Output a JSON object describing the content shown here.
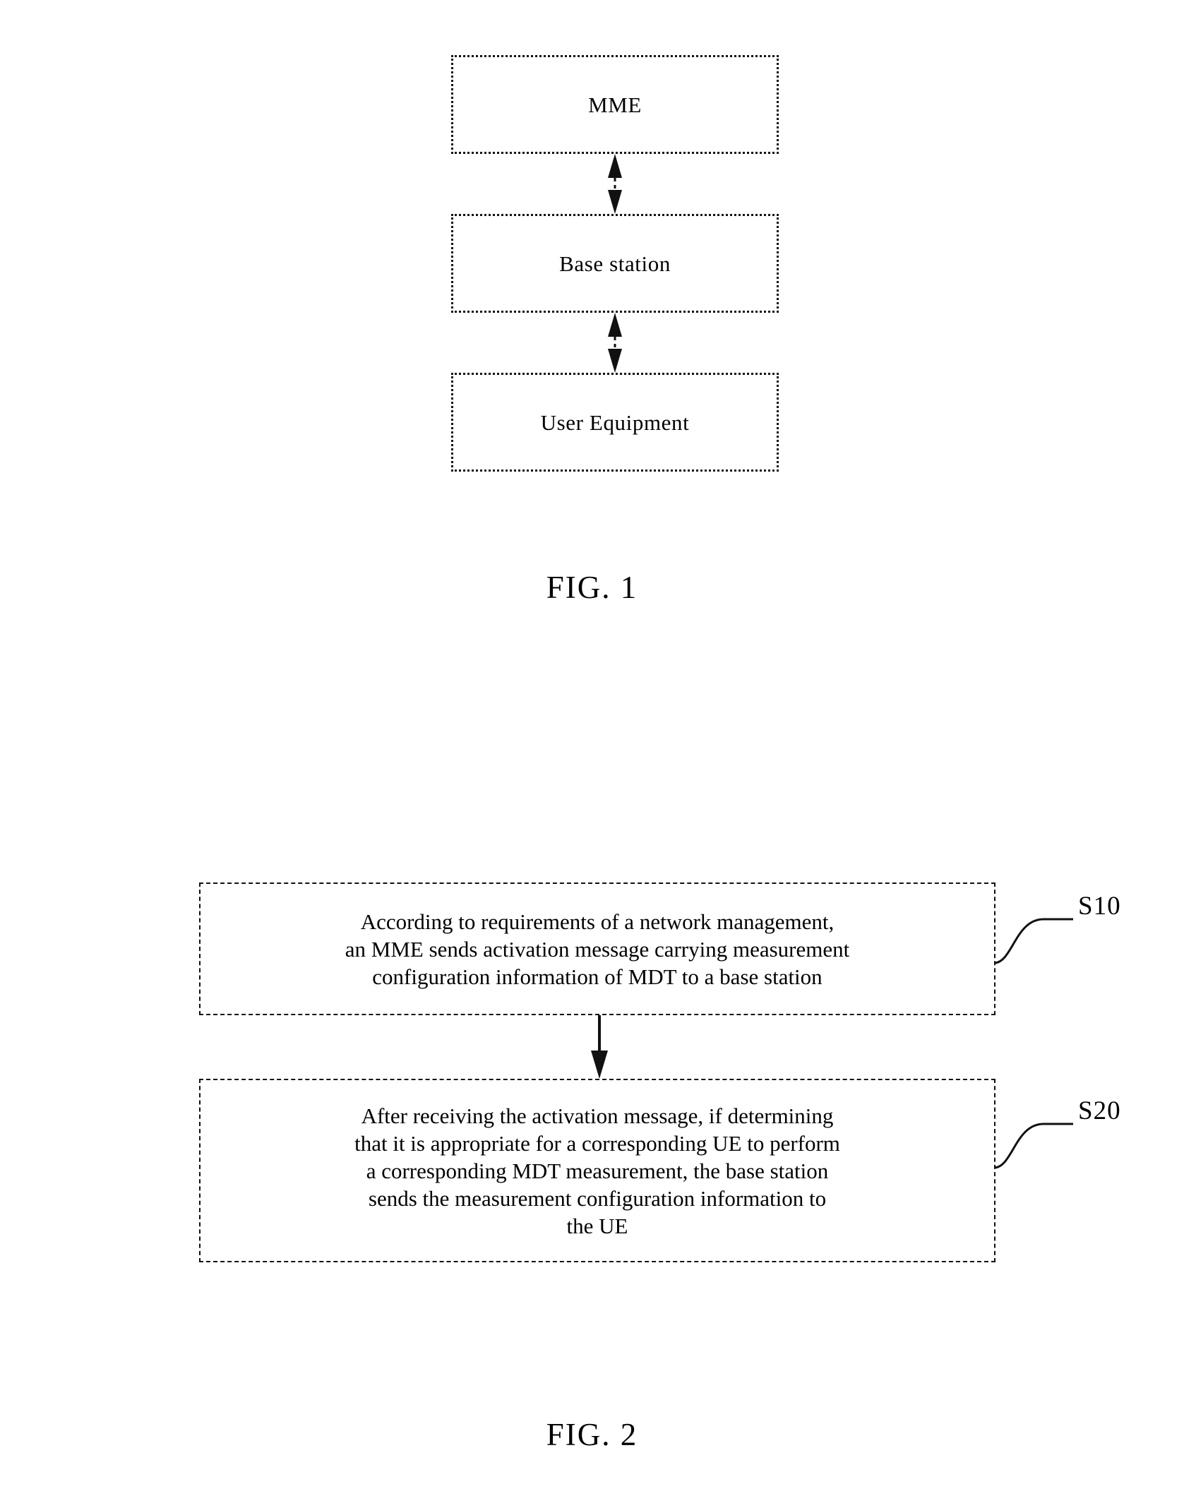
{
  "figure1": {
    "caption": "FIG. 1",
    "nodes": [
      {
        "id": "mme",
        "label": "MME"
      },
      {
        "id": "base_station",
        "label": "Base station"
      },
      {
        "id": "user_equipment",
        "label": "User Equipment"
      }
    ],
    "connectors": [
      {
        "id": "mme-bs",
        "style": "double-headed-dashed-arrow"
      },
      {
        "id": "bs-ue",
        "style": "double-headed-dashed-arrow"
      }
    ]
  },
  "figure2": {
    "caption": "FIG. 2",
    "steps": [
      {
        "id": "s10",
        "ref": "S10",
        "lines": [
          "According to requirements of a network management,",
          "an MME sends activation message carrying measurement",
          "configuration information of MDT to a base station"
        ]
      },
      {
        "id": "s20",
        "ref": "S20",
        "lines": [
          "After receiving the activation message, if determining",
          "that it is appropriate for a corresponding UE to perform",
          "a corresponding MDT measurement, the base station",
          "sends the measurement configuration information to",
          "the UE"
        ]
      }
    ],
    "connectors": [
      {
        "id": "s10-s20",
        "style": "down-arrow"
      }
    ]
  },
  "colors": {
    "ink": "#000000",
    "paper": "#ffffff"
  }
}
